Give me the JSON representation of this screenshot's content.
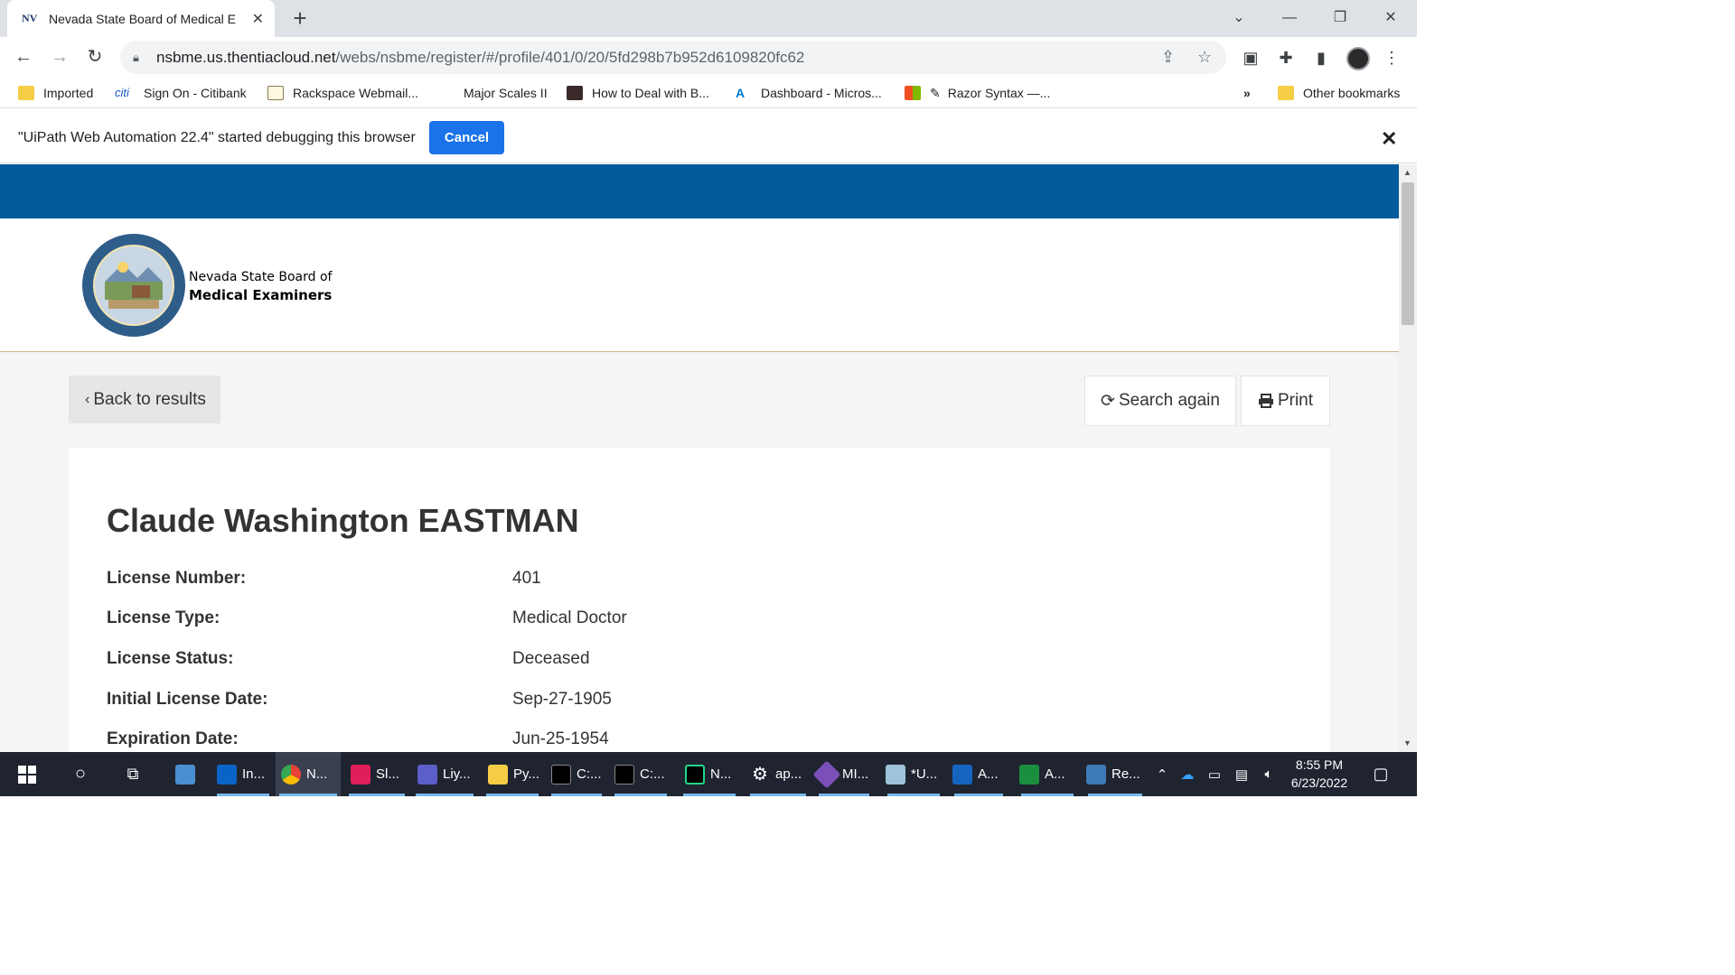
{
  "browser": {
    "tab_favicon": "NV",
    "tab_title": "Nevada State Board of Medical E",
    "url_host": "nsbme.us.thentiacloud.net",
    "url_path": "/webs/nsbme/register/#/profile/401/0/20/5fd298b7b952d6109820fc62",
    "bookmarks": [
      "Imported",
      "Sign On - Citibank",
      "Rackspace Webmail...",
      "Major Scales II",
      "How to Deal with B...",
      "Dashboard - Micros...",
      "Razor Syntax —...",
      "»",
      "Other bookmarks"
    ],
    "info_text": "\"UiPath Web Automation 22.4\" started debugging this browser",
    "cancel_label": "Cancel"
  },
  "site": {
    "brand_line1": "Nevada State Board of",
    "brand_line2": "Medical Examiners",
    "back_label": "Back to results",
    "search_again_label": "Search again",
    "print_label": "Print"
  },
  "profile": {
    "name": "Claude Washington EASTMAN",
    "fields": [
      {
        "label": "License Number:",
        "value": "401"
      },
      {
        "label": "License Type:",
        "value": "Medical Doctor"
      },
      {
        "label": "License Status:",
        "value": "Deceased"
      },
      {
        "label": "Initial License Date:",
        "value": "Sep-27-1905"
      },
      {
        "label": "Expiration Date:",
        "value": "Jun-25-1954"
      }
    ]
  },
  "taskbar": {
    "items": [
      "In...",
      "N...",
      "Sl...",
      "Liy...",
      "Py...",
      "C:...",
      "C:...",
      "N...",
      "ap...",
      "MI...",
      "*U...",
      "A...",
      "A...",
      "Re..."
    ],
    "time": "8:55 PM",
    "date": "6/23/2022"
  },
  "colors": {
    "site_blue": "#005a9c",
    "accent": "#1a73e8"
  }
}
